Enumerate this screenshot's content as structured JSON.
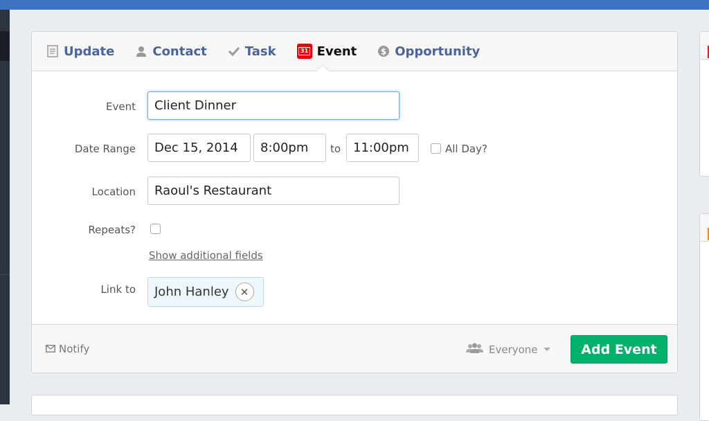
{
  "tabs": [
    {
      "label": "Update",
      "icon": "document-icon"
    },
    {
      "label": "Contact",
      "icon": "person-icon"
    },
    {
      "label": "Task",
      "icon": "checkmark-icon"
    },
    {
      "label": "Event",
      "icon": "calendar-icon",
      "active": true,
      "calendar_day": "31"
    },
    {
      "label": "Opportunity",
      "icon": "dollar-coin-icon"
    }
  ],
  "form": {
    "event_label": "Event",
    "event_value": "Client Dinner",
    "date_label": "Date Range",
    "start_date": "Dec 15, 2014",
    "start_time": "8:00pm",
    "to": "to",
    "end_time": "11:00pm",
    "all_day": "All Day?",
    "location_label": "Location",
    "location_value": "Raoul's Restaurant",
    "repeats_label": "Repeats?",
    "show_more": "Show additional fields",
    "link_label": "Link to",
    "link_value": "John Hanley"
  },
  "footer": {
    "notify": "Notify",
    "visibility": "Everyone",
    "submit": "Add Event"
  },
  "colors": {
    "accent": "#00b06b",
    "tab_text": "#4a649b",
    "topbar": "#3d74bf"
  }
}
